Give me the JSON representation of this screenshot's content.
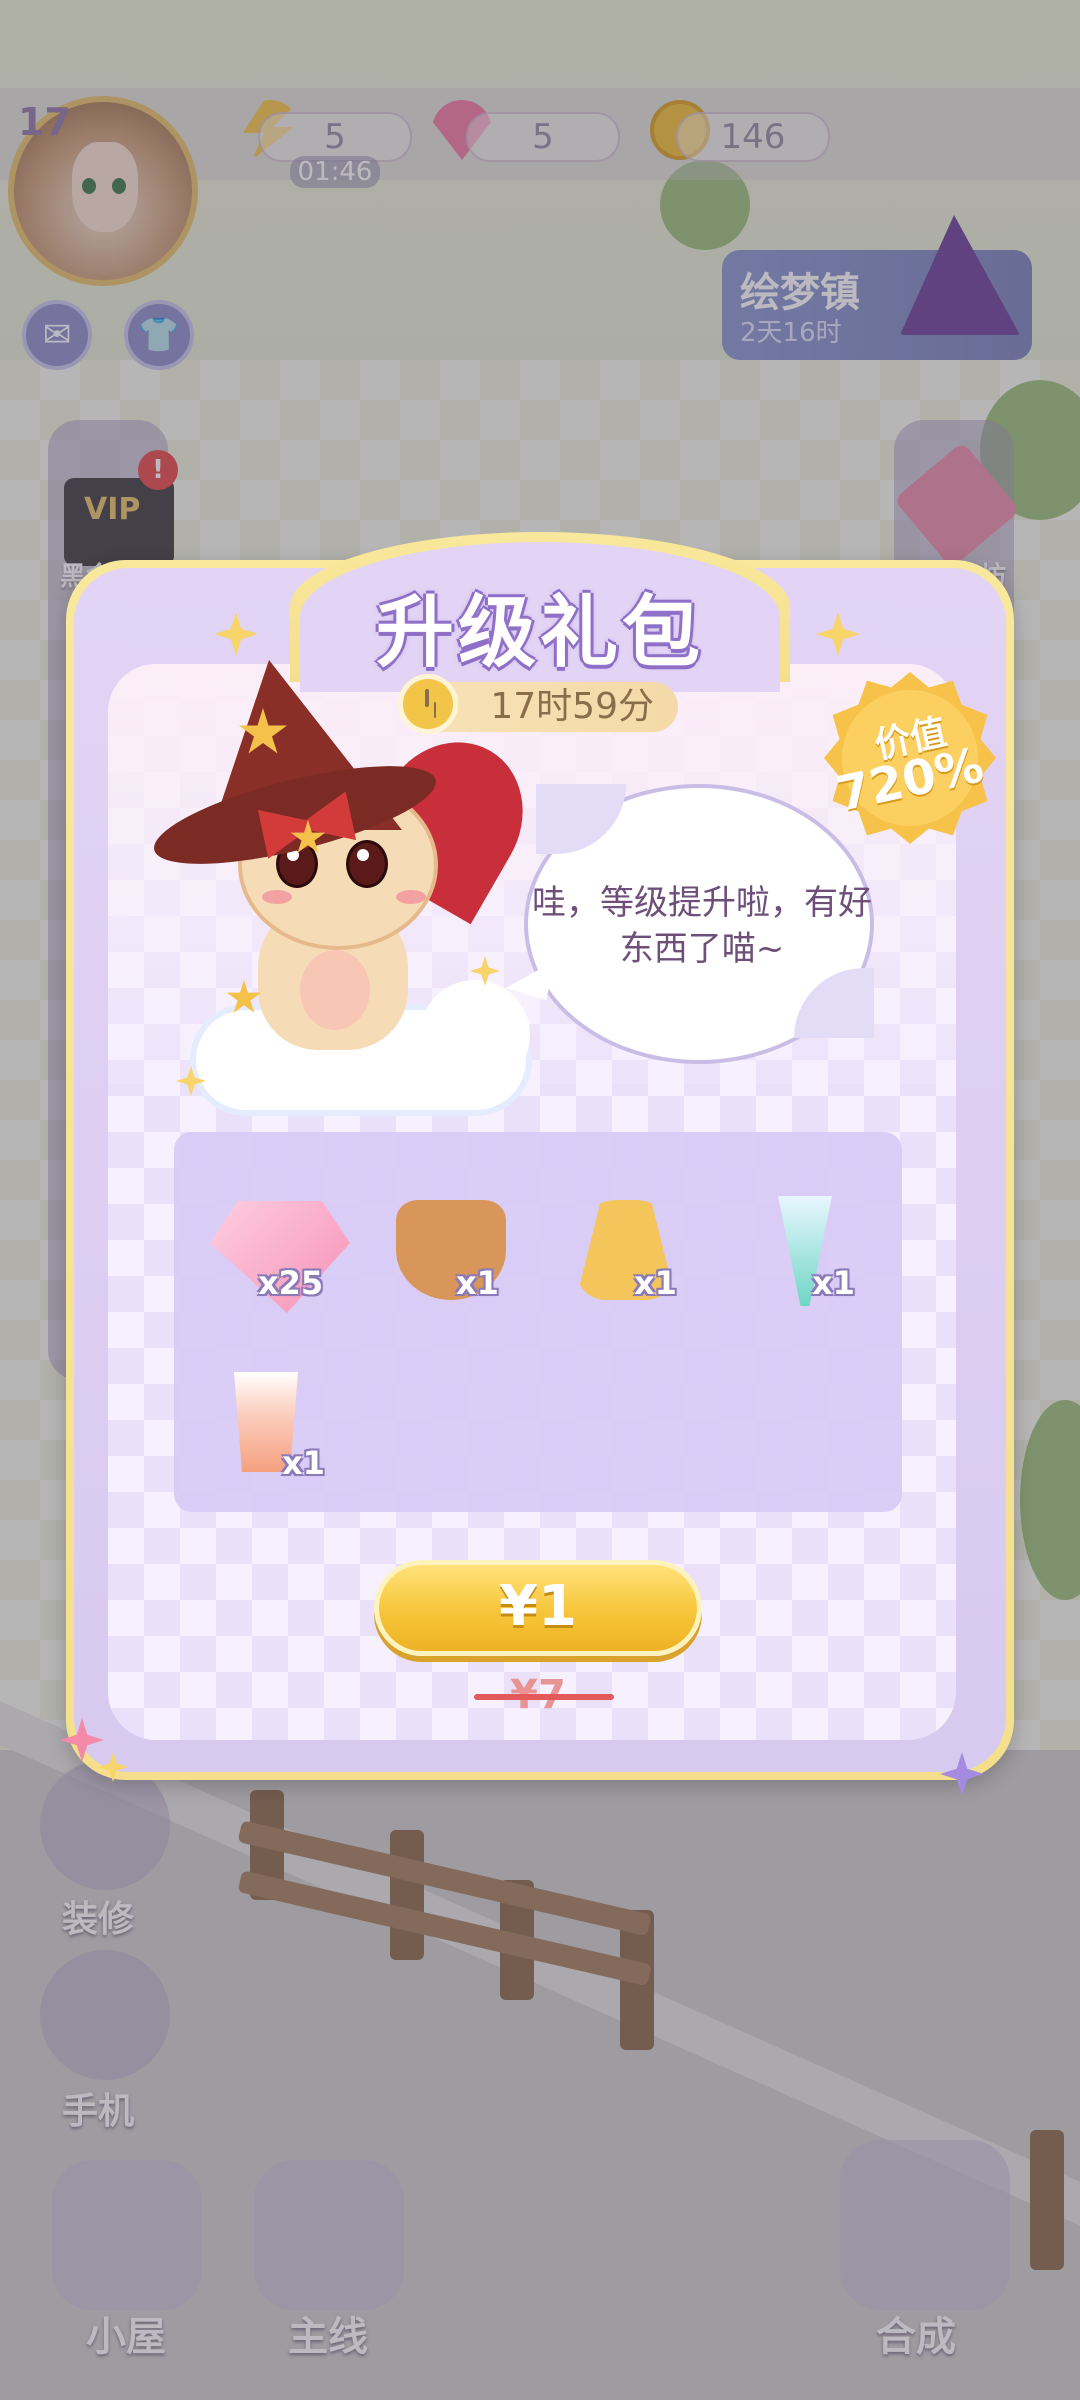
{
  "hud": {
    "level": "17",
    "stamina": "5",
    "stamina_timer": "01:46",
    "gems": "5",
    "coins": "146"
  },
  "event": {
    "title": "绘梦镇",
    "time_left": "2天16时"
  },
  "side": {
    "left_label": "黑金特权",
    "right_label": "设计工坊",
    "vip": "VIP",
    "notify": "!"
  },
  "left_buttons": [
    {
      "label": "装修"
    },
    {
      "label": "手机"
    }
  ],
  "bottom_buttons": [
    {
      "label": "小屋"
    },
    {
      "label": "主线"
    },
    {
      "label": "合成"
    }
  ],
  "popup": {
    "title": "升级礼包",
    "timer": "17时59分",
    "value_label": "价值",
    "value_percent": "720%",
    "speech": "哇，等级提升啦，有好东西了喵~",
    "rewards": [
      {
        "icon": "gem-icon",
        "qty": "x25"
      },
      {
        "icon": "fruit-basket-icon",
        "qty": "x1"
      },
      {
        "icon": "golden-bag-icon",
        "qty": "x1"
      },
      {
        "icon": "potion-glass-icon",
        "qty": "x1"
      },
      {
        "icon": "parfait-drink-icon",
        "qty": "x1"
      }
    ],
    "price": "¥1",
    "original_price": "¥7"
  }
}
